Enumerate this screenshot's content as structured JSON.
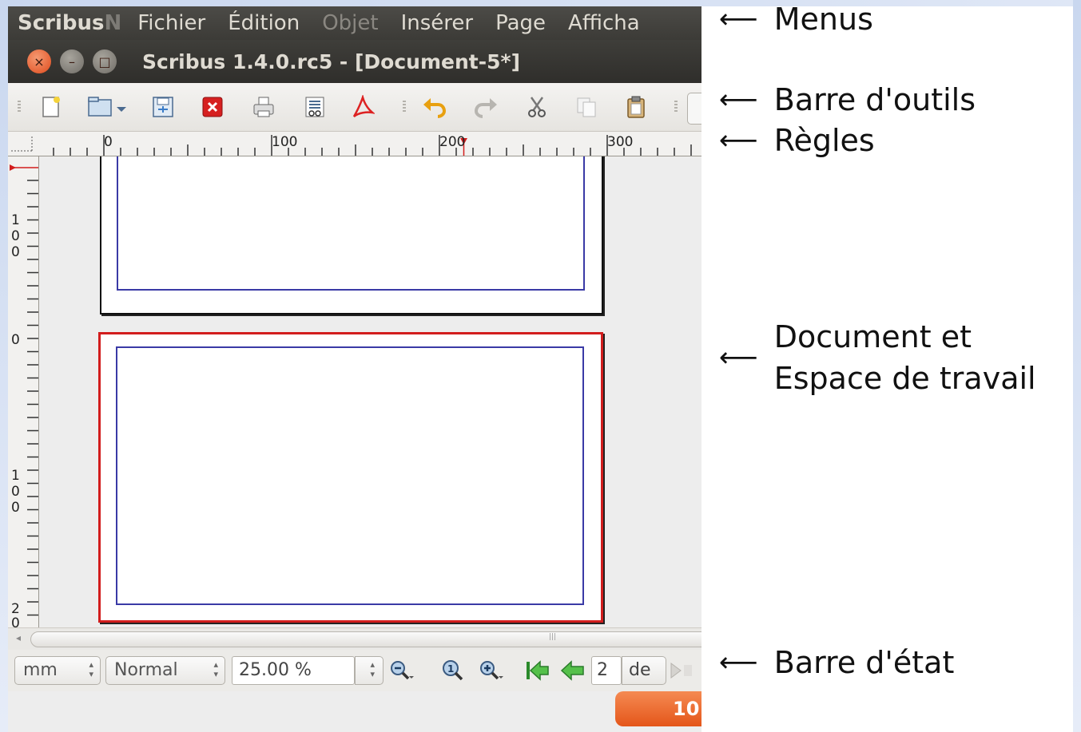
{
  "menubar": {
    "app_name": "Scribus",
    "app_name_fade": "N",
    "items": [
      "Fichier",
      "Édition",
      "Objet",
      "Insérer",
      "Page",
      "Afficha"
    ]
  },
  "titlebar": {
    "title": "Scribus 1.4.0.rc5 - [Document-5*]",
    "close_glyph": "×",
    "min_glyph": "–",
    "max_glyph": "□"
  },
  "toolbar": {
    "icons": [
      "new-document-icon",
      "open-document-icon",
      "save-icon",
      "close-document-icon",
      "print-icon",
      "preflight-icon",
      "export-pdf-icon",
      "undo-icon",
      "redo-icon",
      "cut-icon",
      "copy-icon",
      "paste-icon"
    ]
  },
  "ruler": {
    "h_labels": [
      "0",
      "100",
      "200",
      "300"
    ],
    "v_labels": [
      [
        "1",
        "0",
        "0"
      ],
      [
        "0"
      ],
      [
        "1",
        "0",
        "0"
      ],
      [
        "2",
        "0"
      ]
    ]
  },
  "statusbar": {
    "unit": "mm",
    "mode": "Normal",
    "zoom": "25.00 %",
    "page_current": "2",
    "page_of": "de",
    "page_button": "10"
  },
  "annotations": {
    "menus": "Menus",
    "toolbar": "Barre d'outils",
    "rulers": "Règles",
    "document_line1": "Document et",
    "document_line2": "Espace de travail",
    "statusbar": "Barre d'état",
    "arrow": "⟵"
  },
  "colors": {
    "menubar": "#3c3b37",
    "selected_page_border": "#d21d1d",
    "margin_guides": "#3a3aa6",
    "page_button": "#e4561a"
  }
}
